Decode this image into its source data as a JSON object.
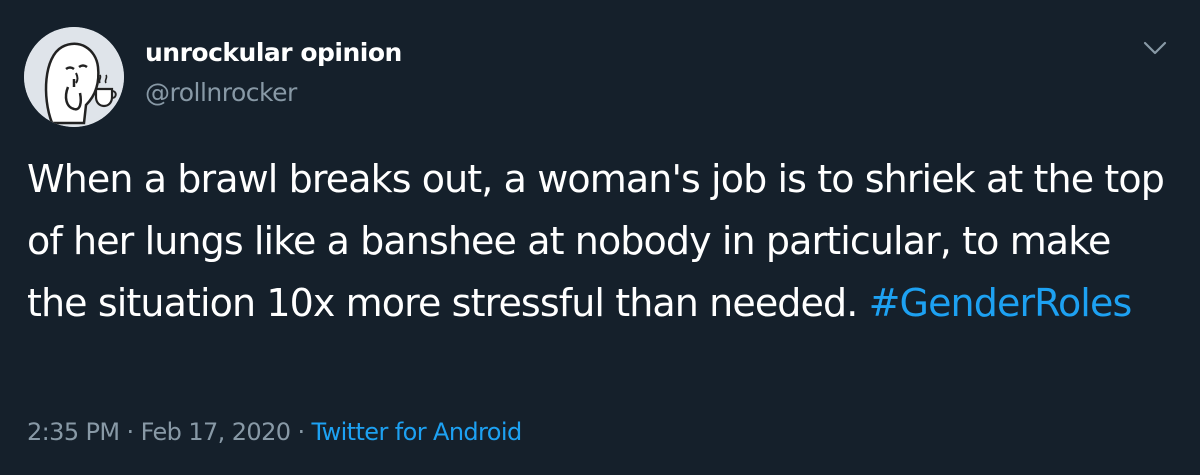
{
  "user": {
    "display_name": "unrockular opinion",
    "handle": "@rollnrocker",
    "avatar_icon": "cartoon-face-drinking-tea-avatar"
  },
  "menu": {
    "icon": "chevron-down-icon"
  },
  "tweet": {
    "text": "When a brawl breaks out, a woman's job is to shriek at the top of her lungs like a banshee at nobody in particular, to make the situation 10x more stressful than needed.",
    "hashtag": "#GenderRoles"
  },
  "meta": {
    "time": "2:35 PM",
    "separator": "·",
    "date": "Feb 17, 2020",
    "source": "Twitter for Android"
  },
  "colors": {
    "background": "#15202b",
    "text": "#ffffff",
    "secondary_text": "#8899a6",
    "accent": "#1da1f2"
  }
}
